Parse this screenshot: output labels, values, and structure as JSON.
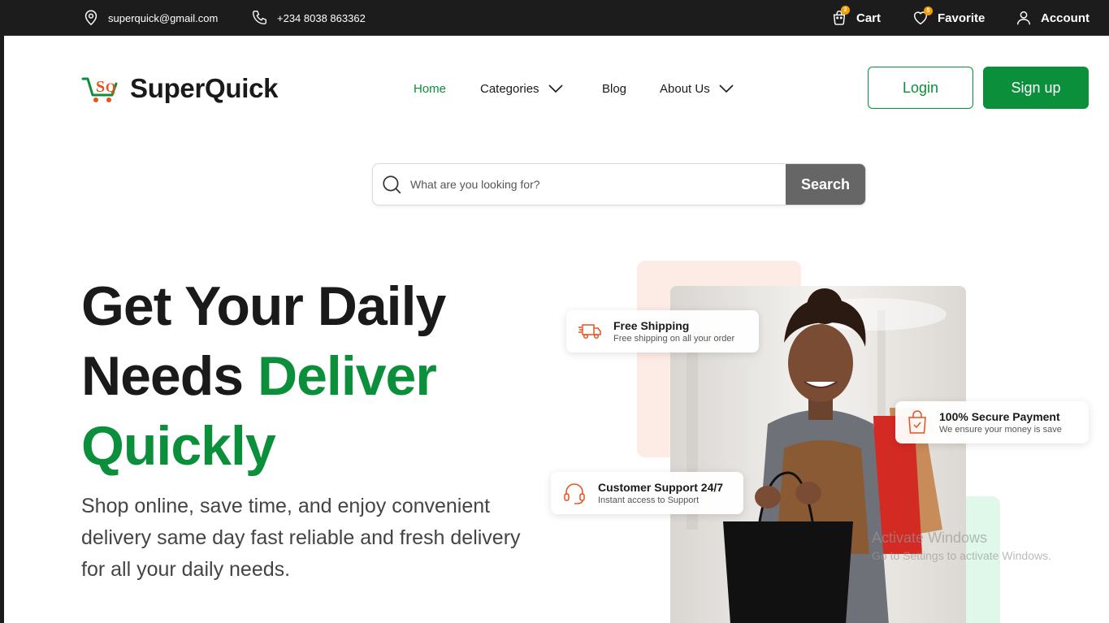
{
  "topbar": {
    "email": "superquick@gmail.com",
    "phone": "+234 8038 863362",
    "cart_label": "Cart",
    "cart_count": "2",
    "favorite_label": "Favorite",
    "favorite_count": "5",
    "account_label": "Account"
  },
  "brand": {
    "name": "SuperQuick",
    "primary_color": "#0b8f3a",
    "accent_color": "#e8501c"
  },
  "nav": {
    "home": "Home",
    "categories": "Categories",
    "blog": "Blog",
    "about": "About Us"
  },
  "auth": {
    "login": "Login",
    "signup": "Sign up"
  },
  "search": {
    "placeholder": "What are you looking for?",
    "button": "Search"
  },
  "hero": {
    "line1": "Get Your Daily",
    "line2_dark": "Needs ",
    "line2_green": "Deliver",
    "line3_green": "Quickly",
    "subtitle": "Shop online, save time, and enjoy convenient delivery same day fast reliable and fresh delivery for all your daily needs."
  },
  "features": {
    "shipping": {
      "title": "Free Shipping",
      "subtitle": "Free shipping on all your order",
      "icon": "truck-icon"
    },
    "payment": {
      "title": "100% Secure Payment",
      "subtitle": "We ensure your money is save",
      "icon": "shopping-bag-icon"
    },
    "support": {
      "title": "Customer Support 24/7",
      "subtitle": "Instant access to Support",
      "icon": "headset-icon"
    }
  },
  "watermark": {
    "line1": "Activate Windows",
    "line2": "Go to Settings to activate Windows."
  }
}
